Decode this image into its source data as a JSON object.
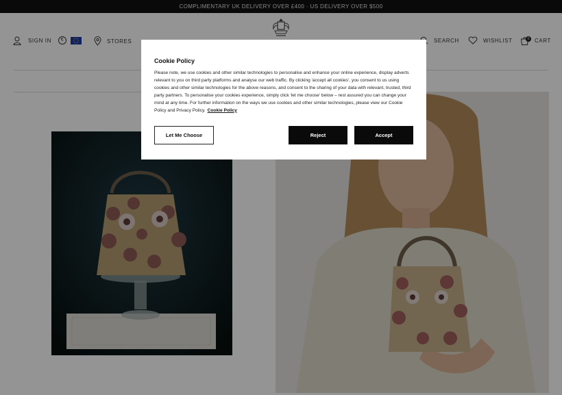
{
  "promo_bar": {
    "text": "COMPLIMENTARY UK DELIVERY OVER £400 · US DELIVERY OVER $500"
  },
  "header": {
    "sign_in": "SIGN IN",
    "currency_symbol": "€",
    "stores": "STORES",
    "search": "SEARCH",
    "wishlist": "WISHLIST",
    "cart": "CART",
    "cart_count": "0"
  },
  "cookie_modal": {
    "title": "Cookie Policy",
    "body": "Please note, we use cookies and other similar technologies to personalise and enhance your online experience, display adverts relevant to you on third party platforms and analyse our web traffic. By clicking 'accept all cookies', you consent to us using cookies and other similar technologies for the above reasons, and consent to the sharing of your data with relevant, trusted, third party partners. To personalise your cookies experience, simply click 'let me choose' below – rest assured you can change your mind at any time. For further information on the ways we use cookies and other similar technologies, please view our Cookie Policy and Privacy Policy.",
    "link": "Cookie Policy",
    "let_me_choose": "Let Me Choose",
    "reject": "Reject",
    "accept": "Accept"
  },
  "colors": {
    "promo_bg": "#111111",
    "button_dark": "#0a0a0a",
    "eu_flag": "#1c3aa8"
  }
}
